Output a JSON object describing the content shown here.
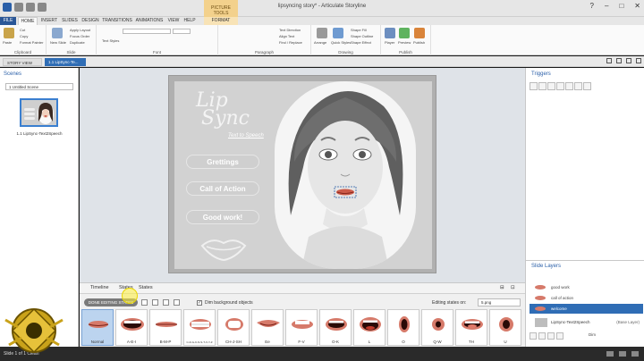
{
  "window": {
    "title": "lipsyncing story* - Articulate Storyline",
    "tool_context": "PICTURE TOOLS"
  },
  "ribbon_tabs": [
    "FILE",
    "HOME",
    "INSERT",
    "SLIDES",
    "DESIGN",
    "TRANSITIONS",
    "ANIMATIONS",
    "VIEW",
    "HELP",
    "FORMAT"
  ],
  "ribbon": {
    "clipboard": {
      "paste": "Paste",
      "cut": "Cut",
      "copy": "Copy",
      "format_painter": "Format Painter",
      "label": "Clipboard"
    },
    "slide": {
      "new_slide": "New Slide",
      "apply_layout": "Apply Layout",
      "focus_order": "Focus Order",
      "duplicate": "Duplicate",
      "label": "Slide"
    },
    "font": {
      "text_styles": "Text Styles",
      "label": "Font"
    },
    "paragraph": {
      "text_direction": "Text Direction",
      "align_text": "Align Text",
      "find_replace": "Find / Replace",
      "label": "Paragraph"
    },
    "drawing": {
      "arrange": "Arrange",
      "quick_styles": "Quick Styles",
      "shape_fill": "Shape Fill",
      "shape_outline": "Shape Outline",
      "shape_effect": "Shape Effect",
      "label": "Drawing"
    },
    "publish": {
      "player": "Player",
      "preview": "Preview",
      "publish": "Publish",
      "label": "Publish"
    }
  },
  "doc_tabs": {
    "story_view": "STORY VIEW",
    "slide": "1.1 LipSync-Te..."
  },
  "scenes": {
    "title": "Scenes",
    "dropdown": "1 Untitled Scene",
    "thumb_label": "1.1 LipSync-Text2Speech"
  },
  "slide": {
    "logo_line1": "Lip",
    "logo_line2": "Sync",
    "subtitle": "Text to Speech",
    "buttons": [
      "Grettings",
      "Call of Action",
      "Good work!"
    ]
  },
  "states_panel": {
    "tabs": [
      "Timeline",
      "States",
      "States"
    ],
    "done_button": "DONE EDITING STATES",
    "dim_label": "Dim background objects",
    "editing_label": "Editing states on:",
    "editing_value": "5.png",
    "states": [
      {
        "label": "Normal",
        "shape": "closed",
        "selected": true
      },
      {
        "label": "A-E-I",
        "shape": "wide",
        "selected": false
      },
      {
        "label": "B-M-P",
        "shape": "pressed",
        "selected": false
      },
      {
        "label": "C-D-G-K-N-S-T-X-Y-Z",
        "shape": "teeth",
        "selected": false
      },
      {
        "label": "CH-J-SH",
        "shape": "round-teeth",
        "selected": false
      },
      {
        "label": "Ee",
        "shape": "smile",
        "selected": false
      },
      {
        "label": "F-V",
        "shape": "bite",
        "selected": false
      },
      {
        "label": "O-K",
        "shape": "oval",
        "selected": false
      },
      {
        "label": "L",
        "shape": "open",
        "selected": false
      },
      {
        "label": "O",
        "shape": "o",
        "selected": false
      },
      {
        "label": "Q-W",
        "shape": "pucker",
        "selected": false
      },
      {
        "label": "TH",
        "shape": "tongue",
        "selected": false
      },
      {
        "label": "U",
        "shape": "u",
        "selected": false
      }
    ]
  },
  "triggers": {
    "title": "Triggers"
  },
  "slide_layers": {
    "title": "Slide Layers",
    "layers": [
      "good work",
      "call of action",
      "welcome"
    ],
    "selected_layer": "welcome",
    "base_layer": "LipSync-Text2Speech",
    "base_tag": "(Base Layer)",
    "dim_label": "Dim"
  },
  "status": {
    "text": "Slide 1 of 1    Clean"
  },
  "colors": {
    "accent": "#2f6db5",
    "file_tab": "#2b5797",
    "lips": "#d67a6a"
  }
}
